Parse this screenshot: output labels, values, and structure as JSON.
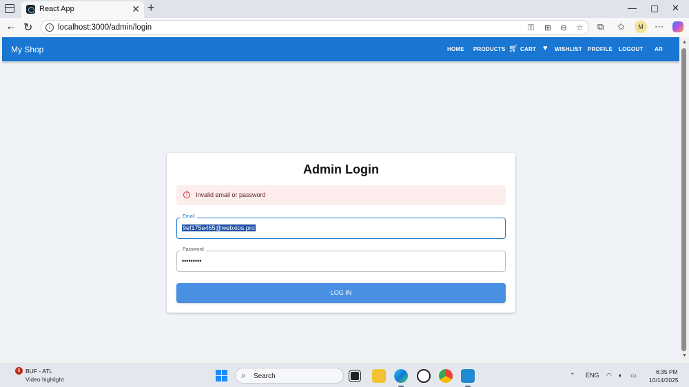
{
  "browser": {
    "tab_title": "React App",
    "tab_close": "✕",
    "new_tab": "+",
    "url": "localhost:3000/admin/login",
    "profile_initial": "M",
    "window_controls": [
      "—",
      "▢",
      "✕"
    ]
  },
  "app": {
    "brand": "My Shop",
    "nav": {
      "home": "HOME",
      "products": "PRODUCTS",
      "cart": "CART",
      "wishlist": "WISHLIST",
      "profile": "PROFILE",
      "logout": "LOGOUT",
      "language": "AR"
    },
    "accent_color": "#1976d2"
  },
  "login": {
    "title": "Admin Login",
    "error": "Invalid email or password",
    "email_label": "Email",
    "email_value": "9ef175e465@webxios.pro",
    "password_label": "Password",
    "password_value": "•••••••••",
    "button": "LOG IN"
  },
  "taskbar": {
    "news_badge": "6",
    "news_title": "BUF - ATL",
    "news_subtitle": "Video highlight",
    "search_placeholder": "Search",
    "language": "ENG",
    "time": "6:35 PM",
    "date": "10/14/2025"
  }
}
